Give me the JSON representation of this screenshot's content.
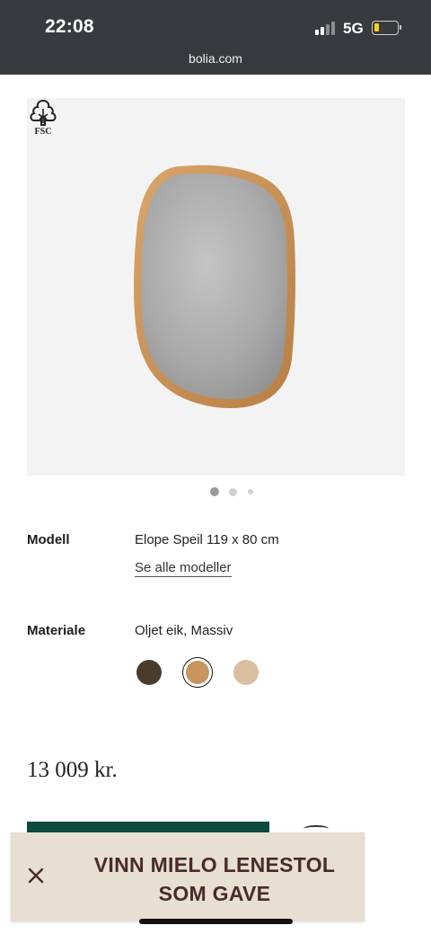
{
  "status_bar": {
    "time": "22:08",
    "network": "5G",
    "battery_level": 0.2,
    "url": "bolia.com"
  },
  "product": {
    "image_alt": "Elope Speil",
    "fsc_label": "FSC",
    "carousel": {
      "total": 3,
      "active_index": 0
    }
  },
  "specs": {
    "model_label": "Modell",
    "model_value": "Elope Speil 119 x 80 cm",
    "see_all_models": "Se alle modeller",
    "material_label": "Materiale",
    "material_value": "Oljet eik, Massiv",
    "swatches": [
      {
        "name": "dark-oak",
        "color": "#4a3b2d",
        "selected": false
      },
      {
        "name": "oiled-oak",
        "color": "#c8955e",
        "selected": true
      },
      {
        "name": "light-oak",
        "color": "#d9bf9d",
        "selected": false
      }
    ]
  },
  "price": "13 009 kr.",
  "promo": {
    "text": "VINN MIELO LENESTOL SOM GAVE",
    "close_icon": "close-icon"
  },
  "colors": {
    "brand_green": "#0f4a3e",
    "promo_bg": "#e6dfd2",
    "promo_text": "#4a2a2b"
  }
}
